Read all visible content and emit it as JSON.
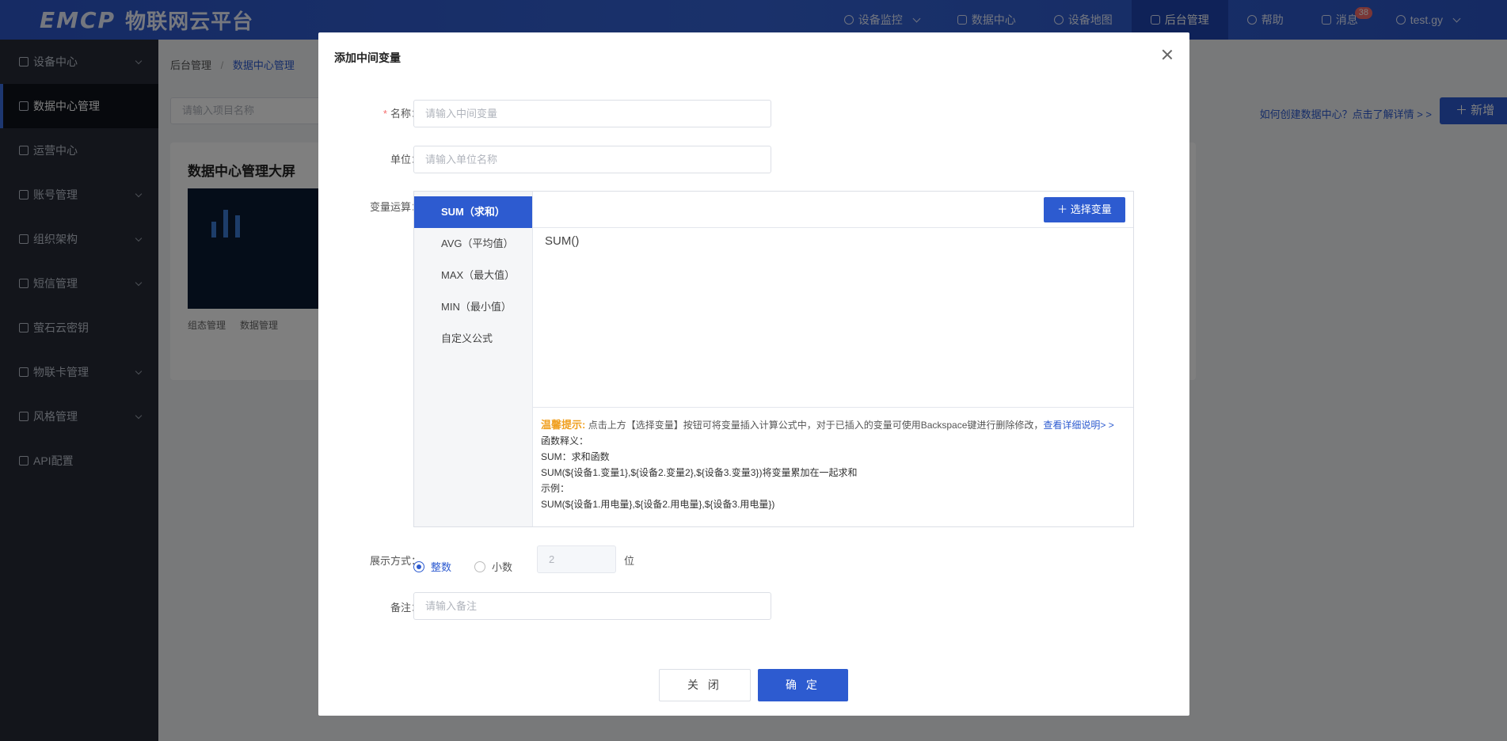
{
  "header": {
    "logo_mark": "EMCP",
    "logo_name": "物联网云平台",
    "nav": [
      {
        "label": "设备监控",
        "icon": "monitor-icon"
      },
      {
        "label": "数据中心",
        "icon": "chart-icon"
      },
      {
        "label": "设备地图",
        "icon": "map-pin-icon"
      },
      {
        "label": "后台管理",
        "icon": "admin-icon",
        "active": true
      },
      {
        "label": "帮助",
        "icon": "help-icon"
      },
      {
        "label": "消息",
        "icon": "message-icon",
        "badge": "38"
      },
      {
        "label": "test.gy",
        "icon": "user-icon"
      }
    ]
  },
  "sidebar": {
    "items": [
      {
        "label": "设备中心"
      },
      {
        "label": "数据中心管理",
        "active": true
      },
      {
        "label": "运营中心"
      },
      {
        "label": "账号管理"
      },
      {
        "label": "组织架构"
      },
      {
        "label": "短信管理"
      },
      {
        "label": "萤石云密钥"
      },
      {
        "label": "物联卡管理"
      },
      {
        "label": "风格管理"
      },
      {
        "label": "API配置"
      }
    ]
  },
  "page": {
    "breadcrumb_root": "后台管理",
    "breadcrumb_sep": "/",
    "breadcrumb_current": "数据中心管理",
    "search_placeholder": "请输入项目名称",
    "help_link": "如何创建数据中心？点击了解详情 > >",
    "add_button": "新增",
    "card_title": "数据中心管理大屏",
    "card_link_1": "组态管理",
    "card_link_2": "数据管理"
  },
  "modal": {
    "title": "添加中间变量",
    "name_label": "名称：",
    "name_placeholder": "请输入中间变量",
    "unit_label": "单位：",
    "unit_placeholder": "请输入单位名称",
    "op_label": "变量运算：",
    "op_tabs": [
      "SUM（求和）",
      "AVG（平均值）",
      "MAX（最大值）",
      "MIN（最小值）",
      "自定义公式"
    ],
    "select_var_button": "选择变量",
    "formula_text": "SUM()",
    "tips": {
      "warm_label": "温馨提示:",
      "tip_text": "点击上方【选择变量】按钮可将变量插入计算公式中，对于已插入的变量可使用Backspace键进行删除修改，",
      "more_link": "查看详细说明> >",
      "line1": "函数释义：",
      "line2": "SUM：求和函数",
      "line3": "SUM(${设备1.变量1},${设备2.变量2},${设备3.变量3})将变量累加在一起求和",
      "line4": "示例：",
      "line5": "SUM(${设备1.用电量},${设备2.用电量},${设备3.用电量})"
    },
    "display_label": "展示方式：",
    "radio_integer": "整数",
    "radio_decimal": "小数",
    "decimal_value": "2",
    "decimal_unit": "位",
    "remark_label": "备注：",
    "remark_placeholder": "请输入备注",
    "close_button": "关 闭",
    "ok_button": "确 定"
  }
}
